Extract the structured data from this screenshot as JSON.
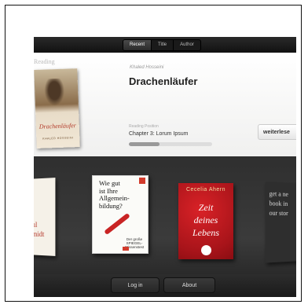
{
  "tabs": [
    {
      "label": "Recent",
      "active": true
    },
    {
      "label": "Title",
      "active": false
    },
    {
      "label": "Author",
      "active": false
    }
  ],
  "reading": {
    "section_label": "Reading",
    "author": "Khaled Hosseini",
    "title": "Drachenläufer",
    "position_label": "Reading Position",
    "chapter": "Chapter 3:  Lorum Ipsum",
    "progress_fraction": 0.37,
    "continue_label": "weiterlese",
    "cover": {
      "title": "Drachenläufer",
      "author": "KHALED HOSSEINI"
    }
  },
  "shelf": {
    "book1_lines": [
      "ul",
      "midt"
    ],
    "book2": {
      "title_lines": [
        "Wie gut",
        "ist Ihre",
        "Allgemein-",
        "bildung?"
      ],
      "subtitle": "Der große SPIEGEL-Wissenstest"
    },
    "book3": {
      "author": "Cecelia Ahern",
      "title_lines": [
        "Zeit",
        "deines",
        "Lebens"
      ]
    },
    "book4_lines": [
      "get a ne",
      "book in",
      "our stor"
    ]
  },
  "bottom": {
    "login_label": "Log in",
    "about_label": "About"
  },
  "colors": {
    "accent_red": "#d23b2c",
    "bar_dark": "#1a1a1a",
    "shelf": "#363636"
  }
}
